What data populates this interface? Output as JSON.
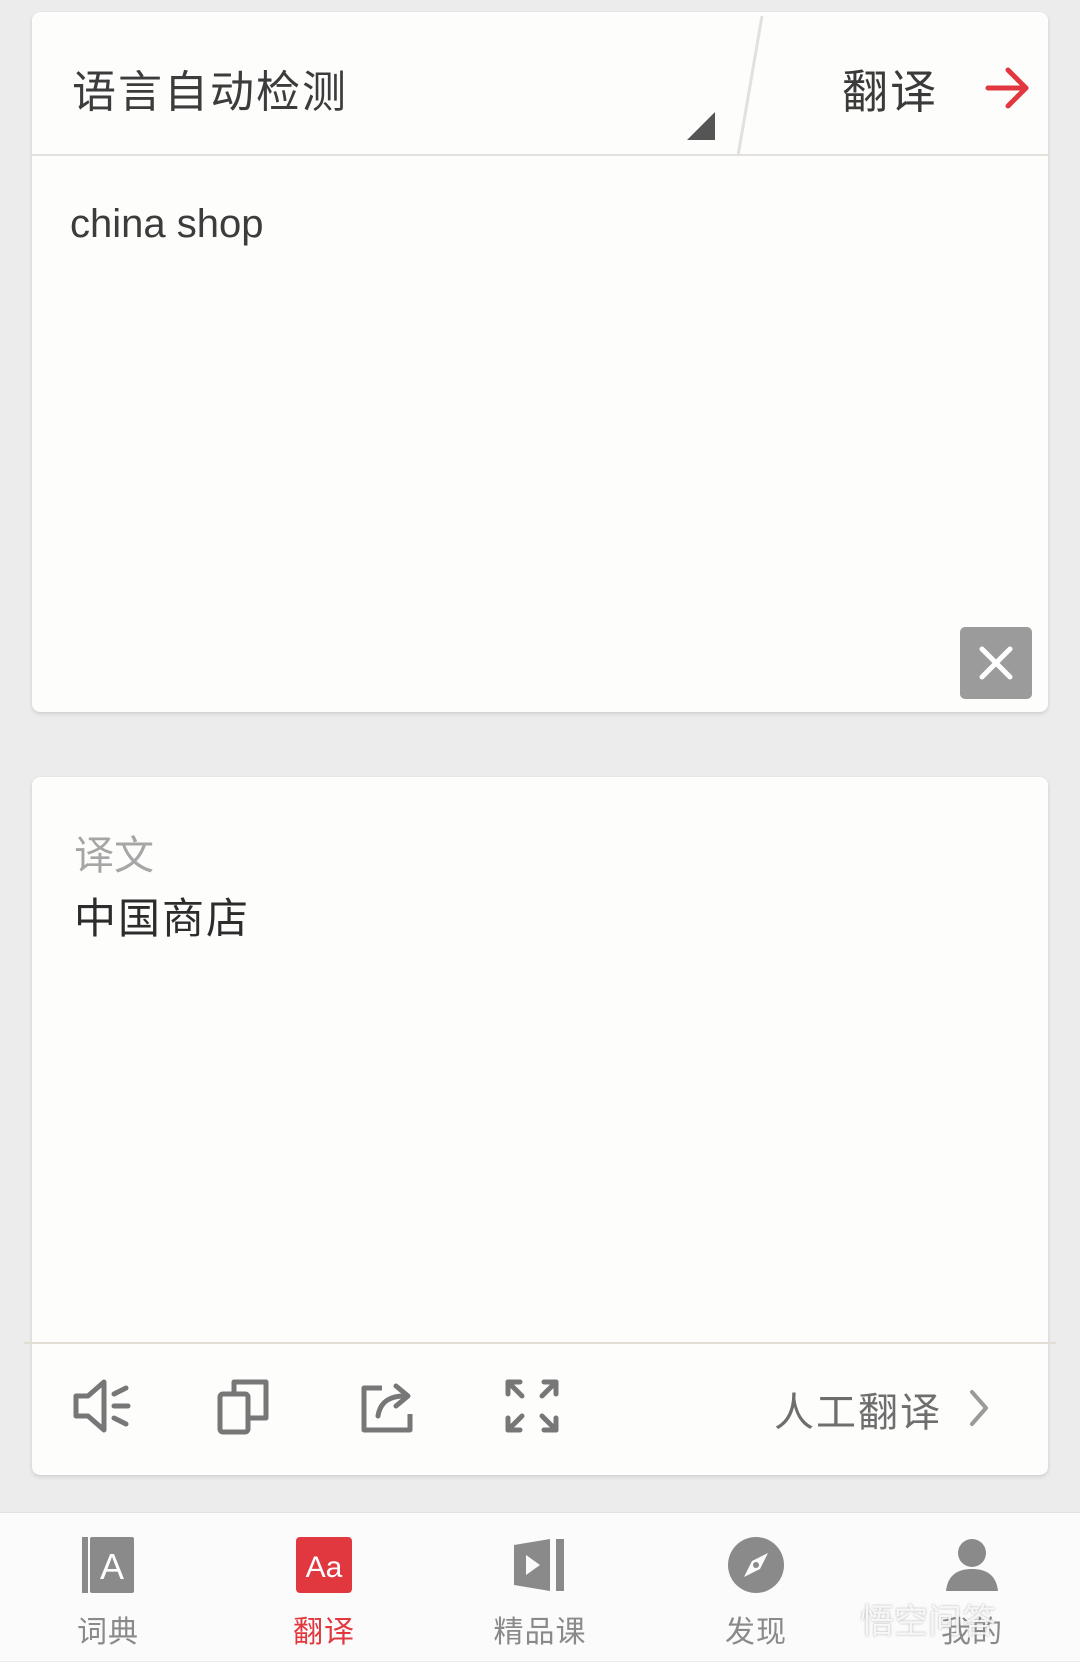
{
  "input": {
    "language_label": "语言自动检测",
    "translate_label": "翻译",
    "source_text": "china shop"
  },
  "result": {
    "label": "译文",
    "text": "中国商店",
    "human_translate_label": "人工翻译"
  },
  "nav": {
    "items": [
      {
        "label": "词典",
        "icon": "dictionary-icon"
      },
      {
        "label": "翻译",
        "icon": "translate-icon"
      },
      {
        "label": "精品课",
        "icon": "course-video-icon"
      },
      {
        "label": "发现",
        "icon": "compass-icon"
      },
      {
        "label": "我的",
        "icon": "user-icon"
      }
    ],
    "active": "翻译"
  },
  "watermark": "悟空问答",
  "colors": {
    "accent": "#e1373f",
    "background": "#ececec",
    "card": "#fdfdfc",
    "icon_gray": "#777777"
  }
}
